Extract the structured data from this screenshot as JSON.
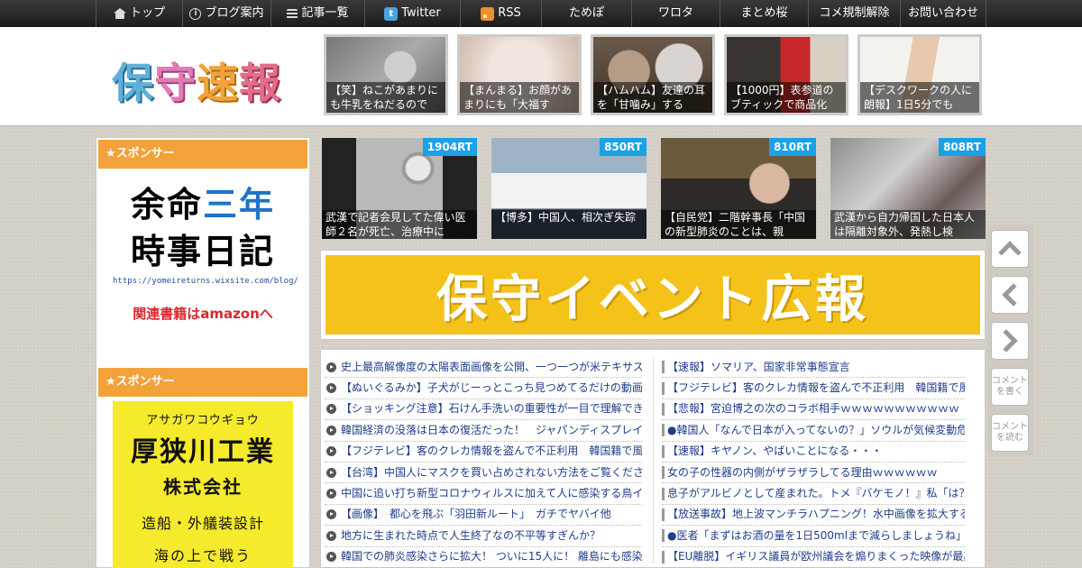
{
  "nav": {
    "items": [
      {
        "label": "トップ",
        "icon": "home-icon"
      },
      {
        "label": "ブログ案内",
        "icon": "info-icon"
      },
      {
        "label": "記事一覧",
        "icon": "list-icon"
      },
      {
        "label": "Twitter",
        "icon": "twitter-icon"
      },
      {
        "label": "RSS",
        "icon": "rss-icon"
      },
      {
        "label": "ためぽ",
        "icon": ""
      },
      {
        "label": "ワロタ",
        "icon": ""
      },
      {
        "label": "まとめ桜",
        "icon": ""
      },
      {
        "label": "コメ規制解除",
        "icon": ""
      },
      {
        "label": "お問い合わせ",
        "icon": ""
      }
    ]
  },
  "header": {
    "logo": [
      "保",
      "守",
      "速",
      "報"
    ],
    "tiles": [
      {
        "caption": "【笑】ねこがあまりにも牛乳をねだるので"
      },
      {
        "caption": "【まんまる】お顔があまりにも「大福す"
      },
      {
        "caption": "【ハムハム】友達の耳を「甘噛み」する"
      },
      {
        "caption": "【1000円】表参道のブティックで商品化"
      },
      {
        "caption": "【デスクワークの人に朗報】1日5分でも"
      }
    ]
  },
  "sidebar": {
    "sponsor_label": "★スポンサー",
    "ad1": {
      "line1a": "余命",
      "line1b": "三年",
      "line2": "時事日記",
      "url": "https://yomeireturns.wixsite.com/blog/",
      "amazon": "関連書籍はamazonへ"
    },
    "ad2": {
      "kana": "アサガワコウギョウ",
      "name": "厚狭川工業",
      "corp": "株式会社",
      "business": "造船・外艤装設計",
      "more": "海の上で戦う"
    }
  },
  "ranking": [
    {
      "rt": "1904RT",
      "caption": "武漢で記者会見してた偉い医師２名が死亡、治療中に"
    },
    {
      "rt": "850RT",
      "caption": "【博多】中国人、相次ぎ失踪"
    },
    {
      "rt": "810RT",
      "caption": "【自民党】二階幹事長「中国の新型肺炎のことは、親"
    },
    {
      "rt": "808RT",
      "caption": "武漢から自力帰国した日本人は隔離対象外、発熱し検"
    }
  ],
  "banner": {
    "text": "保守イベント広報"
  },
  "articles_left": [
    "史上最高解像度の太陽表面画像を公開、一つ一つが米テキサス",
    "【ぬいぐるみか】子犬がじーっとこっち見つめてるだけの動画",
    "【ショッキング注意】石けん手洗いの重要性が一目で理解でき",
    "韓国経済の没落は日本の復活だった！　ジャパンディスプレイ",
    "【フジテレビ】客のクレカ情報を盗んで不正利用　韓国籍で風",
    "【台湾】中国人にマスクを買い占めされない方法をご覧ください",
    "中国に追い打ち新型コロナウィルスに加えて人に感染する鳥イ",
    "【画像】　都心を飛ぶ「羽田新ルート」　ガチでヤバイ他",
    "地方に生まれた時点で人生終了なの不平等すぎんか？",
    "韓国での肺炎感染さらに拡大！ ついに15人に！ 離島にも感染"
  ],
  "articles_right": [
    "【速報】ソマリア、国家非常事態宣言",
    "【フジテレビ】客のクレカ情報を盗んで不正利用　韓国籍で風",
    "【悲報】宮迫博之の次のコラボ相手ｗｗｗｗｗｗｗｗｗｗｗ",
    "●韓国人「なんで日本が入ってないの？」ソウルが気候変動危",
    "【速報】キヤノン、やばいことになる・・・",
    "女の子の性器の内側がザラザラしてる理由ｗｗｗｗｗｗ",
    "息子がアルビノとして産まれた。トメ『バケモノ！』私「は？",
    "【放送事故】地上波マンチラハプニング！水中画像を拡大する",
    "●医者「まずはお酒の量を1日500mlまで減らしましょうね」ワ",
    "【EU離脱】イギリス議員が欧州議会を煽りまくった映像が最高"
  ],
  "float": {
    "comment_write": "コメントを書く",
    "comment_read": "コメントを読む"
  }
}
